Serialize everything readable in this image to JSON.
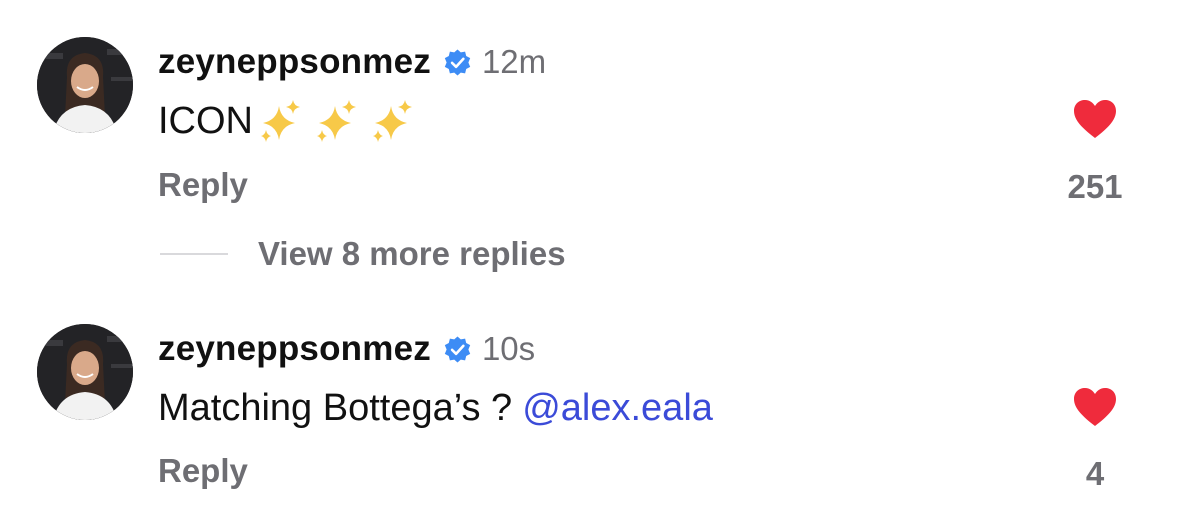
{
  "comments": [
    {
      "username": "zeyneppsonmez",
      "time": "12m",
      "text": "ICON",
      "emoji": [
        "sparkles-icon",
        "sparkles-icon",
        "sparkles-icon"
      ],
      "reply_label": "Reply",
      "likes": "251",
      "liked": true
    },
    {
      "username": "zeyneppsonmez",
      "time": "10s",
      "text": "Matching Bottega’s ?",
      "mention": "@alex.eala",
      "reply_label": "Reply",
      "likes": "4",
      "liked": true
    }
  ],
  "thread": {
    "more_replies_label": "View 8 more replies"
  },
  "colors": {
    "heart": "#ef2b3c",
    "verified": "#3d8cf5",
    "mention": "#3b4bd8",
    "secondary_text": "#6e6e73"
  }
}
